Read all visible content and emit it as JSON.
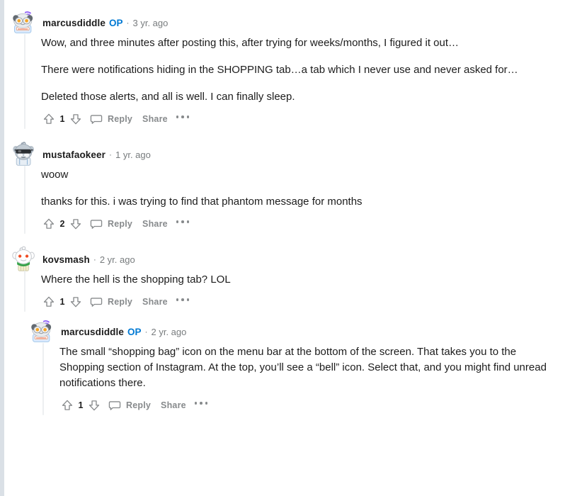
{
  "theme": {
    "accent_blue": "#0079d3",
    "text_color": "#1c1c1c",
    "meta_gray": "#787c7e",
    "action_gray": "#878a8c",
    "thread_line": "#edeff1",
    "page_gutter": "#dae0e6",
    "background": "#ffffff"
  },
  "action_labels": {
    "reply": "Reply",
    "share": "Share",
    "more": "•••",
    "upvote_icon": "upvote-arrow-icon",
    "downvote_icon": "downvote-arrow-icon",
    "comment_icon": "comment-bubble-icon",
    "more_icon": "more-options-icon"
  },
  "comments": [
    {
      "id": "c1",
      "depth": 0,
      "author": "marcusdiddle",
      "is_op": true,
      "op_label": "OP",
      "separator": "·",
      "timestamp": "3 yr. ago",
      "avatar_style": "panda-helmet",
      "score": "1",
      "paragraphs": [
        "Wow, and three minutes after posting this, after trying for weeks/months, I figured it out…",
        "There were notifications hiding in the SHOPPING tab…a tab which I never use and never asked for…",
        "Deleted those alerts, and all is well. I can finally sleep."
      ]
    },
    {
      "id": "c2",
      "depth": 0,
      "author": "mustafaokeer",
      "is_op": false,
      "op_label": "",
      "separator": "·",
      "timestamp": "1 yr. ago",
      "avatar_style": "gray-sunglasses",
      "score": "2",
      "paragraphs": [
        "woow",
        "thanks for this. i was trying to find that phantom message for months"
      ]
    },
    {
      "id": "c3",
      "depth": 0,
      "author": "kovsmash",
      "is_op": false,
      "op_label": "",
      "separator": "·",
      "timestamp": "2 yr. ago",
      "avatar_style": "classic-snoo-scarf",
      "score": "1",
      "paragraphs": [
        "Where the hell is the shopping tab? LOL"
      ]
    },
    {
      "id": "c4",
      "depth": 1,
      "author": "marcusdiddle",
      "is_op": true,
      "op_label": "OP",
      "separator": "·",
      "timestamp": "2 yr. ago",
      "avatar_style": "panda-helmet",
      "score": "1",
      "paragraphs": [
        "The small “shopping bag” icon on the menu bar at the bottom of the screen. That takes you to the Shopping section of Instagram. At the top, you’ll see a “bell” icon. Select that, and you might find unread notifications there."
      ]
    }
  ]
}
